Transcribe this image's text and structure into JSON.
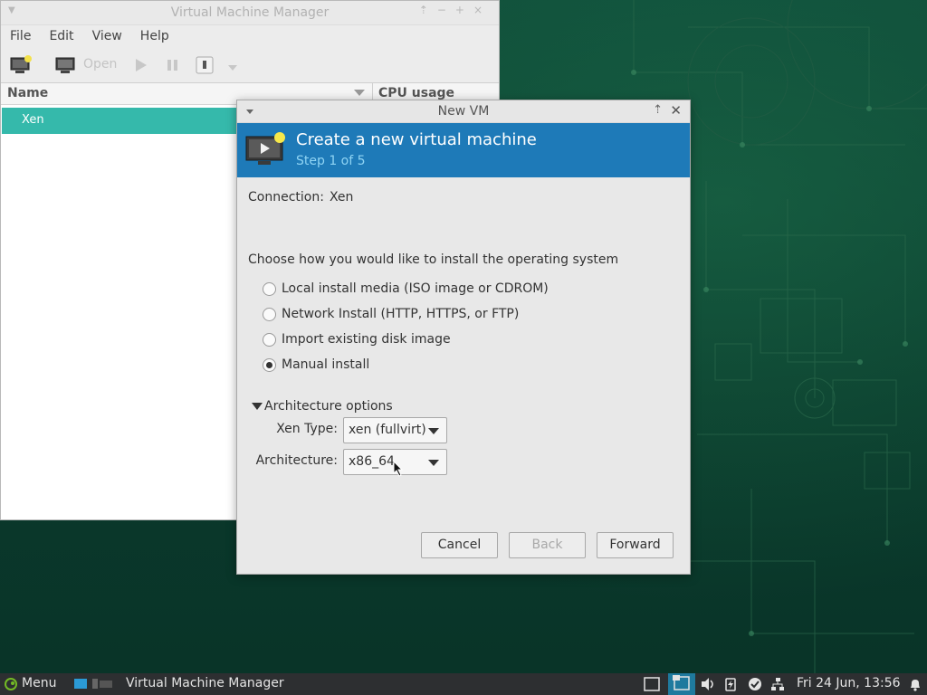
{
  "colors": {
    "selection": "#35b9ab",
    "banner": "#1e7ab8",
    "step_text": "#8fd4f4",
    "taskbar": "#2d2f31"
  },
  "vmm_window": {
    "title": "Virtual Machine Manager",
    "menu": [
      "File",
      "Edit",
      "View",
      "Help"
    ],
    "toolbar": {
      "new_vm_icon": "monitor-new-icon",
      "console_icon": "monitor-icon",
      "open_label": "Open",
      "run_icon": "play-icon",
      "pause_icon": "pause-icon",
      "shutdown_icon": "power-icon",
      "dropdown_icon": "chevron-down-icon"
    },
    "columns": [
      "Name",
      "CPU usage"
    ],
    "rows": [
      {
        "name": "Xen",
        "selected": true
      }
    ]
  },
  "dialog": {
    "title": "New VM",
    "banner_title": "Create a new virtual machine",
    "banner_step": "Step 1 of 5",
    "connection_label": "Connection:",
    "connection_value": "Xen",
    "prompt": "Choose how you would like to install the operating system",
    "install_options": [
      {
        "label": "Local install media (ISO image or CDROM)",
        "checked": false
      },
      {
        "label": "Network Install (HTTP, HTTPS, or FTP)",
        "checked": false
      },
      {
        "label": "Import existing disk image",
        "checked": false
      },
      {
        "label": "Manual install",
        "checked": true
      }
    ],
    "arch_expander": "Architecture options",
    "xen_type_label": "Xen Type:",
    "xen_type_value": "xen (fullvirt)",
    "architecture_label": "Architecture:",
    "architecture_value": "x86_64",
    "buttons": {
      "cancel": "Cancel",
      "back": "Back",
      "forward": "Forward"
    }
  },
  "taskbar": {
    "menu_label": "Menu",
    "app_label": "Virtual Machine Manager",
    "clock": "Fri 24 Jun, 13:56",
    "tray_icons": [
      "workspace-icon",
      "workspace-active-icon",
      "volume-icon",
      "battery-icon",
      "check-icon",
      "network-icon",
      "bell-icon"
    ]
  }
}
